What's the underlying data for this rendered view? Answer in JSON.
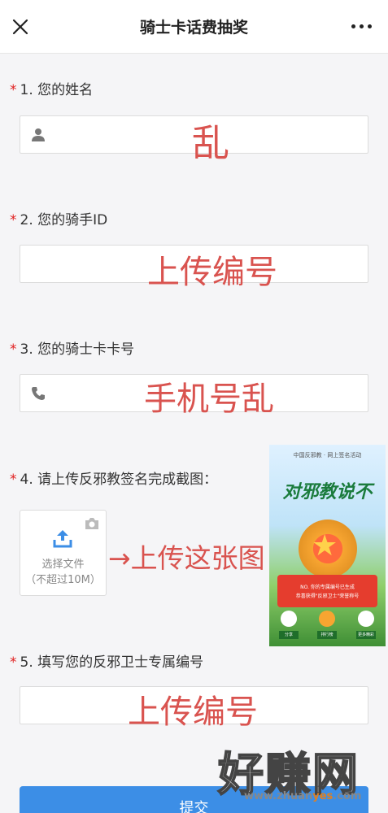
{
  "header": {
    "title": "骑士卡话费抽奖"
  },
  "questions": [
    {
      "number": "1.",
      "label": "您的姓名",
      "required_mark": "*"
    },
    {
      "number": "2.",
      "label": "您的骑手ID",
      "required_mark": "*"
    },
    {
      "number": "3.",
      "label": "您的骑士卡卡号",
      "required_mark": "*"
    },
    {
      "number": "4.",
      "label": "请上传反邪教签名完成截图：",
      "required_mark": "*"
    },
    {
      "number": "5.",
      "label": "填写您的反邪卫士专属编号",
      "required_mark": "*"
    }
  ],
  "annotations": {
    "name": "乱",
    "rider_id": "上传编号",
    "card": "手机号乱",
    "upload": "→上传这张图",
    "number": "上传编号"
  },
  "upload": {
    "line1": "选择文件",
    "line2": "（不超过10M）"
  },
  "poster": {
    "header": "中国反邪教 · 网上签名活动",
    "title": "对邪教说不",
    "ribbon_line1": "NO.  你的专属编号已生成",
    "ribbon_line2": "恭喜获得\"反邪卫士\"荣誉称号",
    "buttons": [
      "分享",
      "排行榜",
      "更多精彩"
    ]
  },
  "submit": {
    "label": "提交"
  },
  "watermark": {
    "main": "好赚网",
    "url_prefix": "www.zhuan",
    "url_highlight": "yes",
    "url_suffix": ".com"
  },
  "colors": {
    "accent": "#3c8ee6",
    "required": "#e02020",
    "annotation": "#d9534f"
  }
}
